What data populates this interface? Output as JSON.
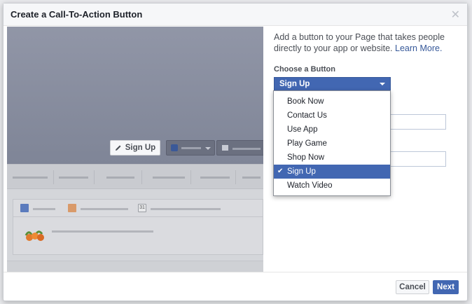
{
  "dialog": {
    "title": "Create a Call-To-Action Button",
    "close_icon": "close-icon"
  },
  "preview": {
    "signup_label": "Sign Up",
    "calendar_day": "31"
  },
  "form": {
    "description": "Add a button to your Page that takes people directly to your app or website.",
    "learn_more": "Learn More.",
    "choose_label": "Choose a Button",
    "selected_button": "Sign Up"
  },
  "menu": {
    "items": [
      {
        "label": "Book Now",
        "selected": false
      },
      {
        "label": "Contact Us",
        "selected": false
      },
      {
        "label": "Use App",
        "selected": false
      },
      {
        "label": "Play Game",
        "selected": false
      },
      {
        "label": "Shop Now",
        "selected": false
      },
      {
        "label": "Sign Up",
        "selected": true
      },
      {
        "label": "Watch Video",
        "selected": false
      }
    ],
    "check_glyph": "✔"
  },
  "footer": {
    "cancel_label": "Cancel",
    "next_label": "Next"
  },
  "colors": {
    "accent": "#4267b2",
    "link": "#365899"
  }
}
